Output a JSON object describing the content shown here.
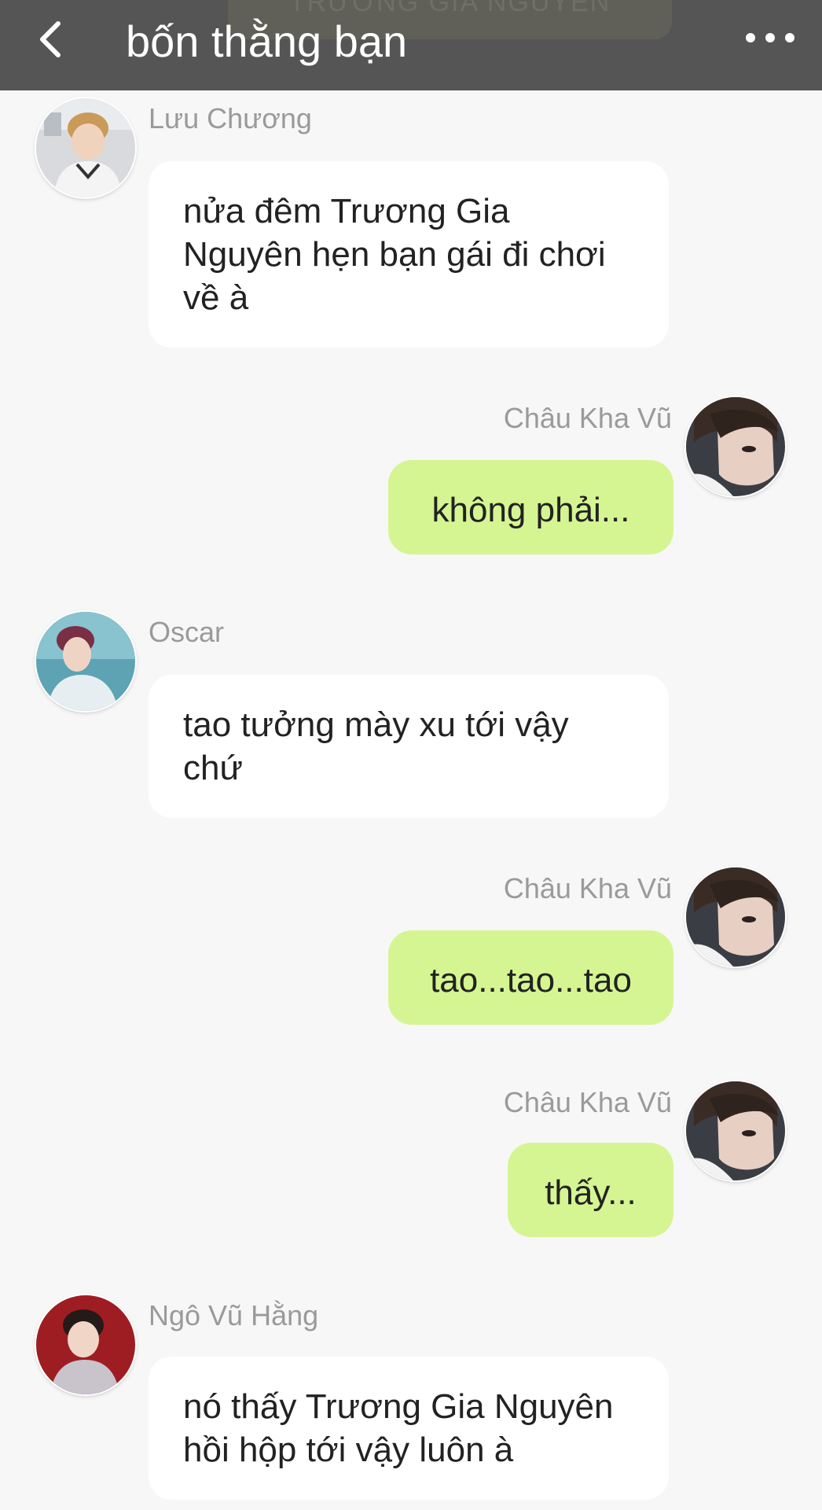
{
  "header": {
    "title": "bốn thằng bạn",
    "pinned_text": "TRƯƠNG GIA NGUYÊN",
    "back_icon": "back-arrow-icon",
    "more_icon": "more-horizontal-icon",
    "background_color": "#555555"
  },
  "colors": {
    "incoming_bubble": "#ffffff",
    "outgoing_bubble": "#d5f592",
    "sender_name": "#9a9a9a",
    "page_background": "#f7f7f7"
  },
  "messages": [
    {
      "sender": "Lưu Chương",
      "direction": "incoming",
      "text": "nửa đêm Trương Gia Nguyên hẹn bạn gái đi chơi về à"
    },
    {
      "sender": "Châu Kha Vũ",
      "direction": "outgoing",
      "text": "không phải..."
    },
    {
      "sender": "Oscar",
      "direction": "incoming",
      "text": "tao tưởng mày xu tới vậy chứ"
    },
    {
      "sender": "Châu Kha Vũ",
      "direction": "outgoing",
      "text": "tao...tao...tao"
    },
    {
      "sender": "Châu Kha Vũ",
      "direction": "outgoing",
      "text": "thấy..."
    },
    {
      "sender": "Ngô Vũ Hằng",
      "direction": "incoming",
      "text": "nó thấy Trương Gia Nguyên hồi hộp tới vậy luôn à"
    }
  ]
}
